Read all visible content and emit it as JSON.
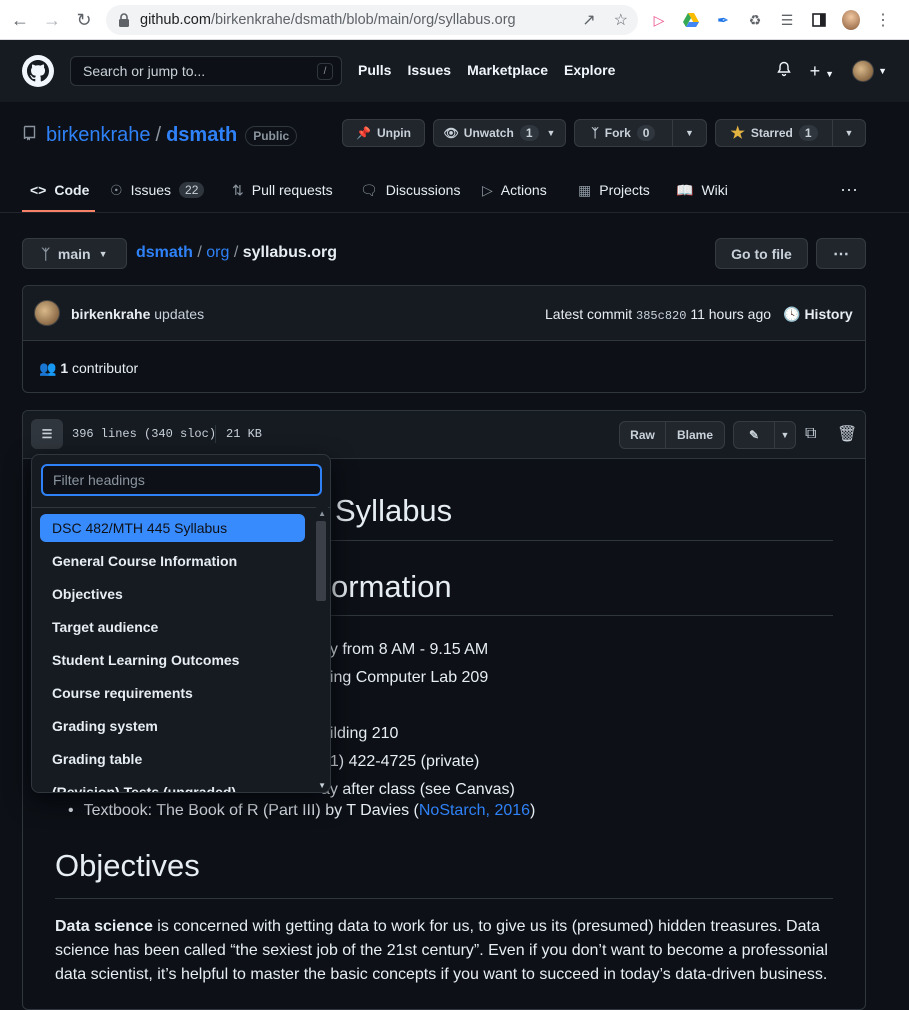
{
  "browser": {
    "url_host": "github.com",
    "url_path": "/birkenkrahe/dsmath/blob/main/org/syllabus.org"
  },
  "header": {
    "search_placeholder": "Search or jump to...",
    "search_shortcut": "/",
    "nav": [
      "Pulls",
      "Issues",
      "Marketplace",
      "Explore"
    ]
  },
  "repo": {
    "owner": "birkenkrahe",
    "name": "dsmath",
    "visibility": "Public",
    "unpin_label": "Unpin",
    "unwatch_label": "Unwatch",
    "unwatch_count": "1",
    "fork_label": "Fork",
    "fork_count": "0",
    "starred_label": "Starred",
    "star_count": "1"
  },
  "tabs": [
    {
      "label": "Code",
      "icon": "code-icon"
    },
    {
      "label": "Issues",
      "icon": "issue-icon",
      "count": "22"
    },
    {
      "label": "Pull requests",
      "icon": "pr-icon"
    },
    {
      "label": "Discussions",
      "icon": "discussion-icon"
    },
    {
      "label": "Actions",
      "icon": "play-icon"
    },
    {
      "label": "Projects",
      "icon": "table-icon"
    },
    {
      "label": "Wiki",
      "icon": "book-icon"
    }
  ],
  "path": {
    "branch": "main",
    "parts": [
      "dsmath",
      "org"
    ],
    "file": "syllabus.org",
    "go_to_file": "Go to file"
  },
  "commit": {
    "author": "birkenkrahe",
    "message": "updates",
    "latest_label": "Latest commit",
    "sha": "385c820",
    "time": "11 hours ago",
    "history_label": "History",
    "contributors_count": "1",
    "contributors_label": "contributor"
  },
  "file": {
    "lines": "396 lines (340 sloc)",
    "size": "21 KB",
    "raw_label": "Raw",
    "blame_label": "Blame"
  },
  "outline": {
    "filter_placeholder": "Filter headings",
    "items": [
      "DSC 482/MTH 445 Syllabus",
      "General Course Information",
      "Objectives",
      "Target audience",
      "Student Learning Outcomes",
      "Course requirements",
      "Grading system",
      "Grading table",
      "(Revision) Tests (ungraded)"
    ]
  },
  "doc": {
    "h1_partial": "Syllabus",
    "h2_partial": "ormation",
    "line1": "ay from 8 AM - 9.15 AM",
    "line2": "ding Computer Lab 209",
    "line3": "uilding 210",
    "line4": "01) 422-4725 (private)",
    "line5": "ay after class (see Canvas)",
    "textbook_prefix": "Textbook: The Book of R (Part III) by T Davies (",
    "textbook_link": "NoStarch, 2016",
    "textbook_suffix": ")",
    "objectives_heading": "Objectives",
    "para_bold": "Data science",
    "para_rest": " is concerned with getting data to work for us, to give us its (presumed) hidden treasures. Data science has been called “the sexiest job of the 21st century”. Even if you don’t want to become a professonial data scientist, it’s helpful to master the basic concepts if you want to succeed in today’s data-driven business."
  }
}
